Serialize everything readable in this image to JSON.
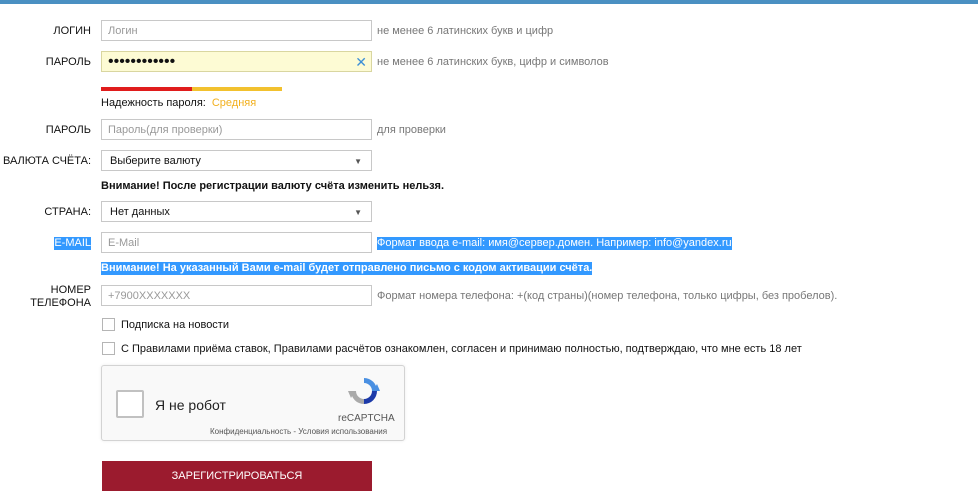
{
  "form": {
    "login": {
      "label": "ЛОГИН",
      "placeholder": "Логин",
      "hint": "не менее 6 латинских букв и цифр"
    },
    "password": {
      "label": "ПАРОЛЬ",
      "value": "••••••••••••",
      "hint": "не менее 6 латинских букв, цифр и символов"
    },
    "strength": {
      "label": "Надежность пароля:",
      "value": "Средняя",
      "fraction": 0.67,
      "colors": [
        "#e01c1c",
        "#f2c12e"
      ]
    },
    "password_confirm": {
      "label": "ПАРОЛЬ",
      "placeholder": "Пароль(для проверки)",
      "hint": "для проверки"
    },
    "currency": {
      "label": "ВАЛЮТА СЧЁТА:",
      "value": "Выберите валюту",
      "warning": "Внимание! После регистрации валюту счёта изменить нельзя."
    },
    "country": {
      "label": "СТРАНА:",
      "value": "Нет данных"
    },
    "email": {
      "label": "E-MAIL",
      "placeholder": "E-Mail",
      "hint": "Формат ввода e-mail: имя@сервер.домен. Например: info@yandex.ru",
      "warning": "Внимание! На указанный Вами e-mail будет отправлено письмо с кодом активации счёта."
    },
    "phone": {
      "label": "НОМЕР ТЕЛЕФОНА",
      "placeholder": "+7900XXXXXXX",
      "hint": "Формат номера телефона: +(код страны)(номер телефона, только цифры, без пробелов)."
    },
    "newsletter": {
      "label": "Подписка на новости",
      "checked": false
    },
    "terms": {
      "label": "С Правилами приёма ставок, Правилами расчётов ознакомлен, согласен и принимаю полностью, подтверждаю, что мне есть 18 лет",
      "checked": false
    },
    "captcha": {
      "label": "Я не робот",
      "brand": "reCAPTCHA",
      "links": "Конфиденциальность - Условия использования"
    },
    "submit_label": "ЗАРЕГИСТРИРОВАТЬСЯ"
  },
  "colors": {
    "accent_bar": "#4a90c2",
    "button": "#9b1b2e",
    "selection": "#3399ff",
    "autofill": "#fdfbd4"
  }
}
